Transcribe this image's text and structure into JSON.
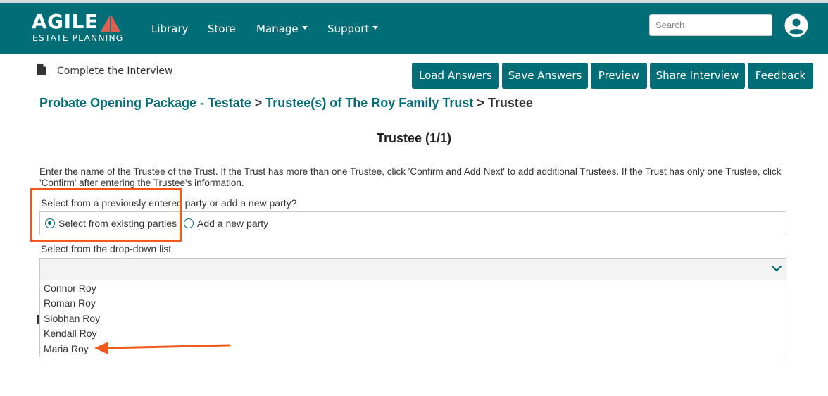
{
  "brand": {
    "logo_main": "AGILE",
    "logo_sub": "ESTATE PLANNING",
    "primary_color": "#006d77",
    "accent_color": "#f05a1a",
    "logo_triangle_color": "#e0604f"
  },
  "nav": {
    "library": "Library",
    "store": "Store",
    "manage": "Manage",
    "support": "Support"
  },
  "search": {
    "placeholder": "Search"
  },
  "user": {
    "icon": "user-circle-icon"
  },
  "subheader": {
    "icon": "document-icon",
    "title": "Complete the Interview"
  },
  "toolbar": {
    "load_answers": "Load Answers",
    "save_answers": "Save Answers",
    "preview": "Preview",
    "share_interview": "Share Interview",
    "feedback": "Feedback"
  },
  "breadcrumb": {
    "item1": "Probate Opening Package - Testate",
    "sep1": " > ",
    "item2": "Trustee(s) of The Roy Family Trust",
    "sep2": " > ",
    "current": "Trustee"
  },
  "section": {
    "title": "Trustee (1/1)"
  },
  "instructions": "Enter the name of the Trustee of the Trust. If the Trust has more than one Trustee, click 'Confirm and Add Next' to add additional Trustees. If the Trust has only one Trustee, click 'Confirm' after entering the Trustee's information.",
  "party_question": {
    "label": "Select from a previously entered party or add a new party?",
    "option_existing": "Select from existing parties",
    "option_new": "Add a new party",
    "selected": "Select from existing parties"
  },
  "dropdown": {
    "label": "Select from the drop-down list",
    "value": "",
    "icon": "chevron-down-icon",
    "options": [
      "Connor Roy",
      "Roman Roy",
      "Siobhan Roy",
      "Kendall Roy",
      "Maria Roy"
    ]
  }
}
